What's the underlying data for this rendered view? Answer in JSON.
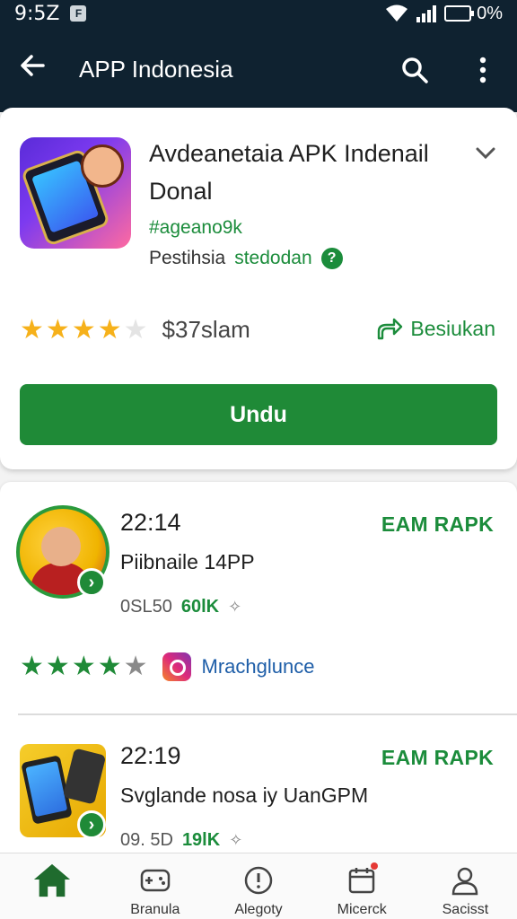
{
  "status_bar": {
    "time": "9:5Z",
    "notification_icon": "F",
    "battery": "0%"
  },
  "app_bar": {
    "title": "APP Indonesia",
    "back_icon": "arrow-left-icon",
    "search_icon": "search-icon",
    "menu_icon": "more-vert-icon"
  },
  "main_app": {
    "title": "Avdeanetaia APK Indenail Donal",
    "tag": "#ageano9k",
    "sub_prefix": "Pestihsia",
    "sub_link": "stedodan",
    "help_icon": "?",
    "rating_stars": 4,
    "rating_max": 5,
    "price": "$37slam",
    "share_label": "Besiukan",
    "install_label": "Undu"
  },
  "list": [
    {
      "time": "22:14",
      "tag": "EAM RAPK",
      "name": "Piibnaile 14PP",
      "size": "0SL50",
      "downloads": "60lK",
      "rating_stars": 4,
      "social_label": "Mrachglunce"
    },
    {
      "time": "22:19",
      "tag": "EAM RAPK",
      "name": "Svglande nosa iy UanGPM",
      "size": "09. 5D",
      "downloads": "19lK"
    }
  ],
  "bottom_nav": [
    {
      "label": "Branula",
      "icon": "games-icon"
    },
    {
      "label": "Alegoty",
      "icon": "info-circle-icon"
    },
    {
      "label": "Micerck",
      "icon": "calendar-icon"
    },
    {
      "label": "Sacisst",
      "icon": "person-icon"
    }
  ],
  "colors": {
    "app_bar": "#0f2230",
    "accent_green": "#1f8a37",
    "star_gold": "#f6b11a"
  }
}
